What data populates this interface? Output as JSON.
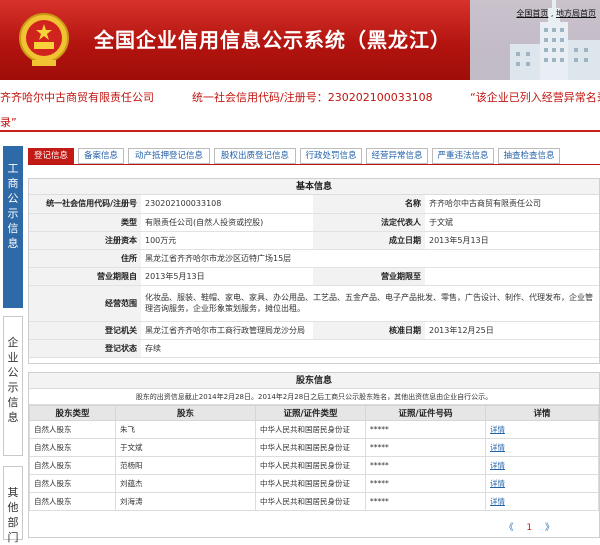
{
  "header": {
    "title": "全国企业信用信息公示系统（黑龙江）",
    "links": [
      "全国首页",
      "地方局首页"
    ]
  },
  "company_bar": {
    "name": "齐齐哈尔中古商贸有限责任公司",
    "credit_code_label": "统一社会信用代码/注册号：230202100033108",
    "alert": "“该企业已列入经营异常名录”"
  },
  "sidebar": {
    "items": [
      "工商公示信息",
      "企业公示信息",
      "其他部门"
    ]
  },
  "tabs": [
    "登记信息",
    "备案信息",
    "动产抵押登记信息",
    "股权出质登记信息",
    "行政处罚信息",
    "经营异常信息",
    "严重违法信息",
    "抽查检查信息"
  ],
  "basic_info": {
    "title": "基本信息",
    "labels": {
      "credit_code": "统一社会信用代码/注册号",
      "name": "名称",
      "type": "类型",
      "legal_rep": "法定代表人",
      "capital": "注册资本",
      "founded": "成立日期",
      "address": "住所",
      "term_from": "营业期限自",
      "term_to": "营业期限至",
      "scope": "经营范围",
      "authority": "登记机关",
      "approval_date": "核准日期",
      "status": "登记状态"
    },
    "values": {
      "credit_code": "230202100033108",
      "name": "齐齐哈尔中古商贸有限责任公司",
      "type": "有限责任公司(自然人投资或控股)",
      "legal_rep": "于文斌",
      "capital": "100万元",
      "founded": "2013年5月13日",
      "address": "黑龙江省齐齐哈尔市龙沙区迈特广场15层",
      "term_from": "2013年5月13日",
      "term_to": "",
      "scope": "化妆品、服装、鞋帽、家电、家具、办公用品、工艺品、五金产品、电子产品批发、零售，广告设计、制作、代理发布，企业管理咨询服务，企业形象策划服务，摊位出租。",
      "authority": "黑龙江省齐齐哈尔市工商行政管理局龙沙分局",
      "approval_date": "2013年12月25日",
      "status": "存续"
    }
  },
  "shareholders": {
    "title": "股东信息",
    "notice": "股东的出资信息截止2014年2月28日。2014年2月28日之后工商只公示股东姓名，其他出资信息由企业自行公示。",
    "columns": [
      "股东类型",
      "股东",
      "证照/证件类型",
      "证照/证件号码",
      "详情"
    ],
    "rows": [
      {
        "type": "自然人股东",
        "name": "朱飞",
        "id_type": "中华人民共和国居民身份证",
        "id_no": "*****",
        "detail": "详情"
      },
      {
        "type": "自然人股东",
        "name": "于文斌",
        "id_type": "中华人民共和国居民身份证",
        "id_no": "*****",
        "detail": "详情"
      },
      {
        "type": "自然人股东",
        "name": "范杨阳",
        "id_type": "中华人民共和国居民身份证",
        "id_no": "*****",
        "detail": "详情"
      },
      {
        "type": "自然人股东",
        "name": "刘蕴杰",
        "id_type": "中华人民共和国居民身份证",
        "id_no": "*****",
        "detail": "详情"
      },
      {
        "type": "自然人股东",
        "name": "刘海涛",
        "id_type": "中华人民共和国居民身份证",
        "id_no": "*****",
        "detail": "详情"
      }
    ],
    "pager": {
      "prev": "《",
      "page": "1",
      "next": "》"
    }
  },
  "colors": {
    "header_red": "#b3140f",
    "alert_red": "#c1140f",
    "active_tab": "#c21b16",
    "side_blue": "#2e6aa8",
    "link_blue": "#2462a8"
  }
}
